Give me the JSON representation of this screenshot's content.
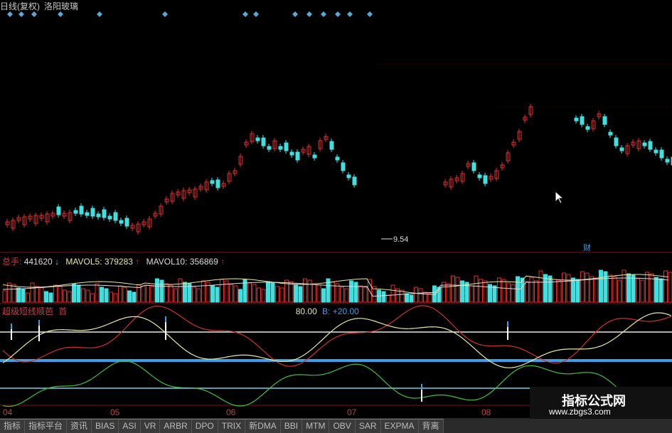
{
  "header": {
    "period": "日线(复权)",
    "symbol": "洛阳玻璃"
  },
  "price_panel": {
    "low_marker": "9.54",
    "cai_badge": "财"
  },
  "volume_panel": {
    "total_label": "总手:",
    "total_value": "441620",
    "total_arrow": "↓",
    "ma5_label": "MAVOL5:",
    "ma5_value": "379283",
    "ma5_arrow": "↑",
    "ma10_label": "MAVOL10:",
    "ma10_value": "356869",
    "ma10_arrow": "↑"
  },
  "indicator_panel": {
    "name": "超级短线顺芭",
    "flag": "首",
    "a_value": "80.00",
    "b_label": "B: +20.00"
  },
  "x_axis": [
    "04",
    "05",
    "06",
    "07",
    "08"
  ],
  "tabs": [
    "指标",
    "指标平台",
    "资讯",
    "BIAS",
    "ASI",
    "VR",
    "ARBR",
    "DPO",
    "TRIX",
    "新DMA",
    "BBI",
    "MTM",
    "OBV",
    "SAR",
    "EXPMA",
    "背离"
  ],
  "watermark": {
    "line1": "指标公式网",
    "line2": "www.zbgs3.com"
  },
  "colors": {
    "up": "#e03030",
    "down": "#40e0e0",
    "bg": "#000000",
    "accent": "#3aa0e8"
  }
}
